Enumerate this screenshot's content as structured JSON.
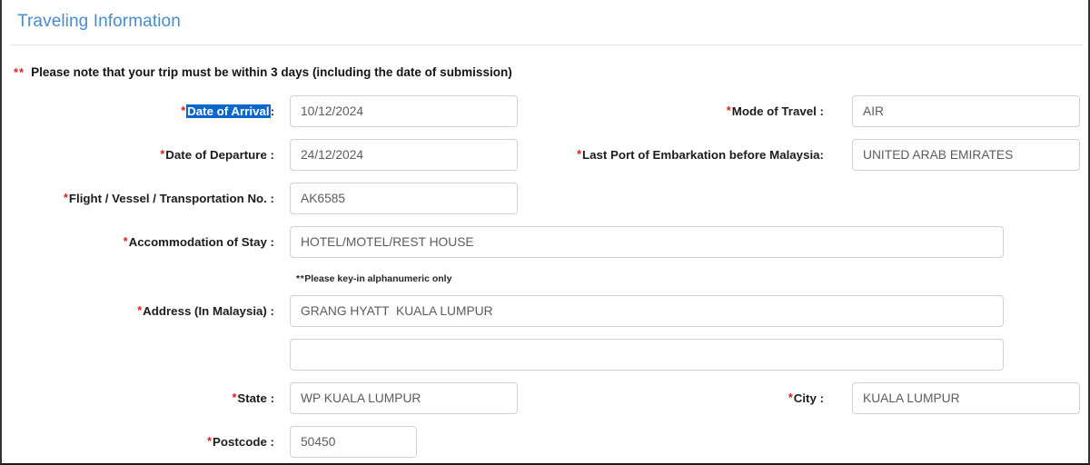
{
  "section": {
    "title": "Traveling Information",
    "note_asterisks": "**",
    "note_text": "Please note that your trip must be within 3 days (including the date of submission)"
  },
  "colors": {
    "title": "#4a8bc9",
    "required_asterisk": "#e01b1b",
    "selection_highlight": "#0a68cc",
    "selection_text": "#ffffff",
    "field_border": "#d2d2d2",
    "field_text": "#5c5c5c",
    "label_text": "#1c1c1c"
  },
  "hint": {
    "asterisks": "**",
    "text": "Please key-in alphanumeric only"
  },
  "fields": {
    "date_of_arrival": {
      "label": "Date of Arrival",
      "colon": ":",
      "required": "*",
      "value": "10/12/2024",
      "selected": true
    },
    "mode_of_travel": {
      "label": "Mode of Travel :",
      "required": "*",
      "value": "AIR"
    },
    "date_of_departure": {
      "label": "Date of Departure :",
      "required": "*",
      "value": "24/12/2024"
    },
    "last_port": {
      "label": "Last Port of Embarkation before Malaysia:",
      "required": "*",
      "value": "UNITED ARAB EMIRATES"
    },
    "flight_no": {
      "label": "Flight / Vessel / Transportation No. :",
      "required": "*",
      "value": "AK6585"
    },
    "accommodation": {
      "label": "Accommodation of Stay :",
      "required": "*",
      "value": "HOTEL/MOTEL/REST HOUSE"
    },
    "address_line1": {
      "label": "Address (In Malaysia) :",
      "required": "*",
      "value": "GRANG HYATT  KUALA LUMPUR"
    },
    "address_line2": {
      "label": "",
      "value": ""
    },
    "state": {
      "label": "State :",
      "required": "*",
      "value": "WP KUALA LUMPUR"
    },
    "city": {
      "label": "City :",
      "required": "*",
      "value": "KUALA LUMPUR"
    },
    "postcode": {
      "label": "Postcode :",
      "required": "*",
      "value": "50450"
    }
  }
}
